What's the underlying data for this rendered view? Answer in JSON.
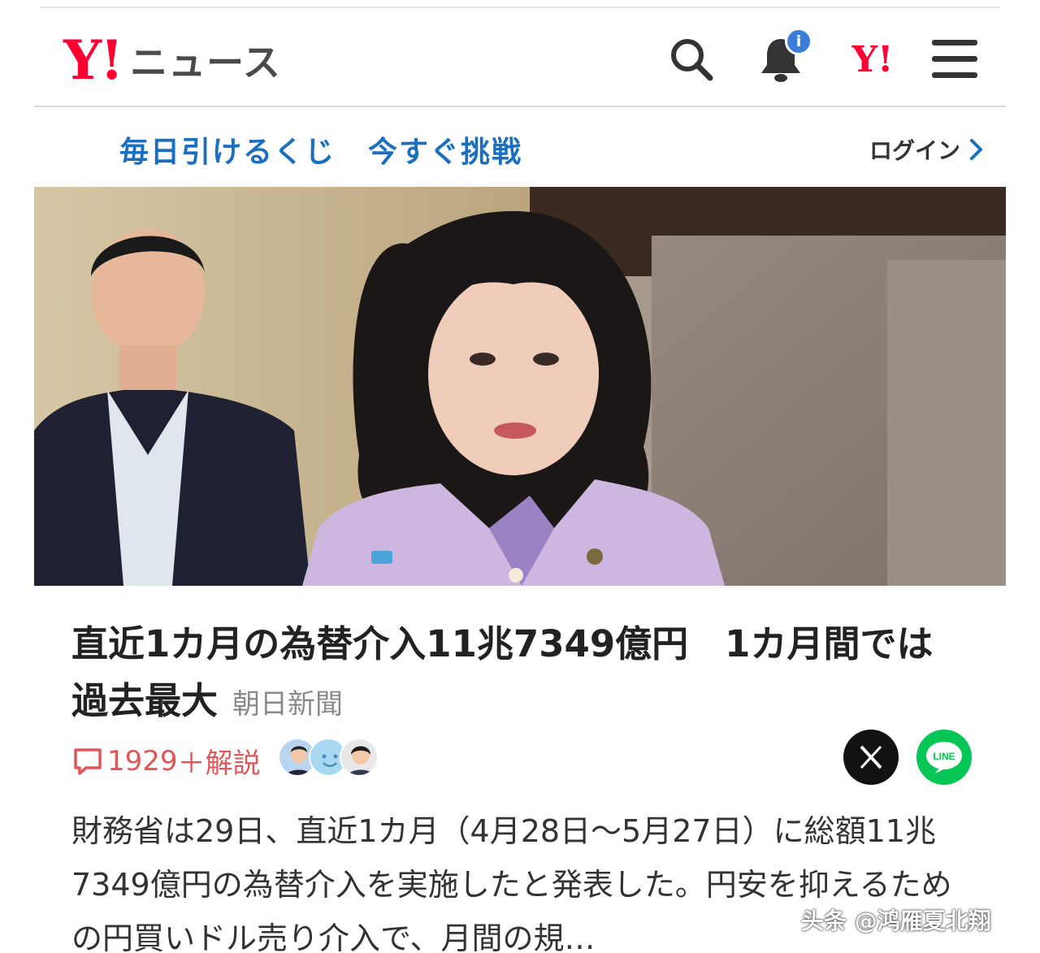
{
  "header": {
    "logo_mark": "Y!",
    "logo_text": "ニュース",
    "notification_badge": "i",
    "yahoo_link": "Y!"
  },
  "subnav": {
    "promo_part1": "毎日引けるくじ",
    "promo_part2": "今すぐ挑戦",
    "login": "ログイン"
  },
  "article": {
    "headline": "直近1カ月の為替介入11兆7349億円　1カ月間では過去最大",
    "source": "朝日新聞",
    "comment_count": "1929",
    "comment_suffix": "＋解説",
    "body": "財務省は29日、直近1カ月（4月28日～5月27日）に総額11兆7349億円の為替介入を実施したと発表した。円安を抑えるための円買いドル売り介入で、月間の規…"
  },
  "share": {
    "x_icon": "x-share-icon",
    "line_label": "LINE"
  },
  "watermark": "头条 @鸿雁夏北翔",
  "colors": {
    "brand_red": "#ff0033",
    "promo_blue": "#1a6fc0",
    "comment_red": "#e2565a",
    "line_green": "#06c755"
  }
}
